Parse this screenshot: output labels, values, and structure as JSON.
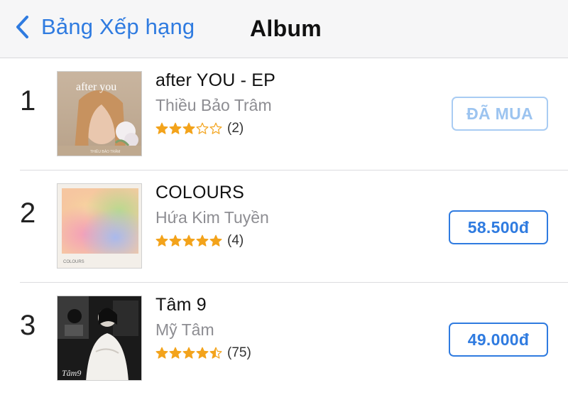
{
  "nav": {
    "back_label": "Bảng Xếp hạng",
    "title": "Album"
  },
  "accent_color": "#2f7be0",
  "star_color": "#f3a31b",
  "albums": [
    {
      "rank": "1",
      "title": "after YOU - EP",
      "artist": "Thiều Bảo Trâm",
      "rating": 3,
      "rating_count": "(2)",
      "button": "ĐÃ MUA",
      "purchased": true,
      "cover_text": "after you",
      "cover_subtext": "THIỀU BẢO TRÂM"
    },
    {
      "rank": "2",
      "title": "COLOURS",
      "artist": "Hứa Kim Tuyền",
      "rating": 5,
      "rating_count": "(4)",
      "button": "58.500đ",
      "purchased": false,
      "cover_text": "COLOURS"
    },
    {
      "rank": "3",
      "title": "Tâm 9",
      "artist": "Mỹ Tâm",
      "rating": 4.5,
      "rating_count": "(75)",
      "button": "49.000đ",
      "purchased": false,
      "cover_text": "Tâm9"
    }
  ]
}
